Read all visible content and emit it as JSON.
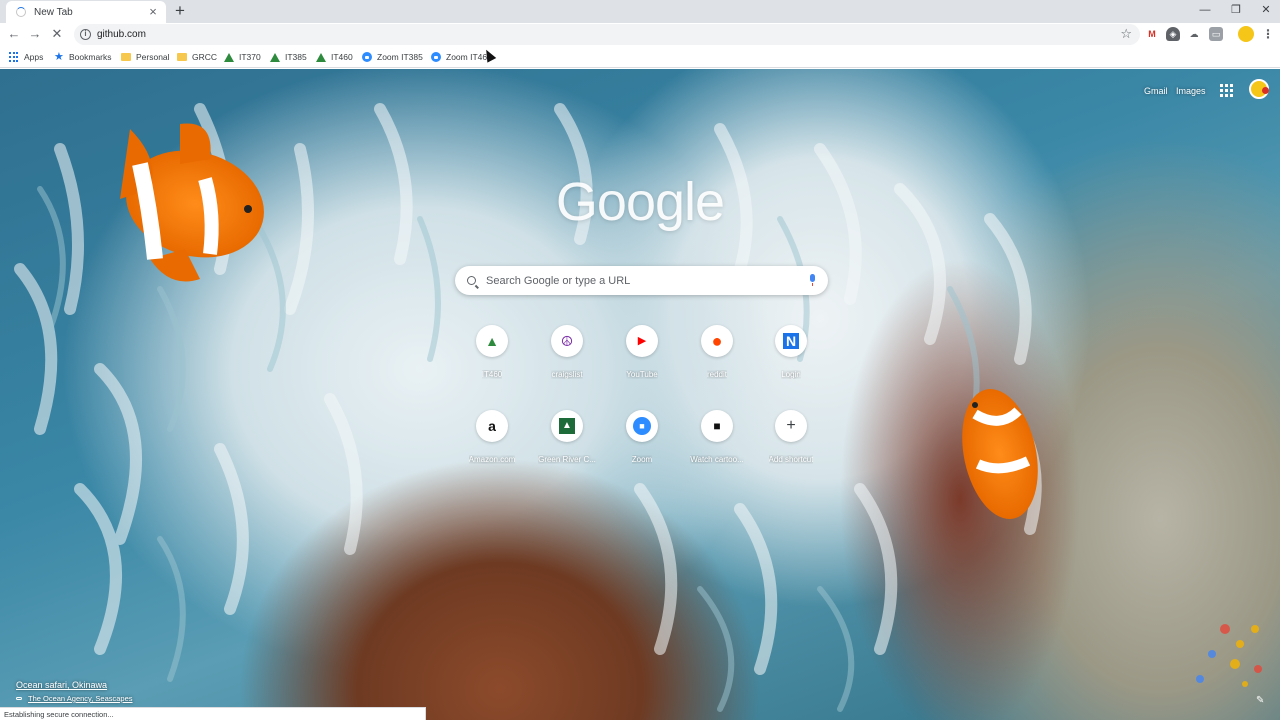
{
  "tab": {
    "title": "New Tab"
  },
  "window_controls": {
    "minimize": "—",
    "restore": "❐",
    "close": "✕"
  },
  "toolbar": {
    "url": "github.com"
  },
  "bookmarks": [
    {
      "label": "Apps",
      "icon": "apps-grid-icon"
    },
    {
      "label": "Bookmarks",
      "icon": "star-icon"
    },
    {
      "label": "Personal",
      "icon": "folder-icon"
    },
    {
      "label": "GRCC",
      "icon": "folder-icon"
    },
    {
      "label": "IT370",
      "icon": "triangle-logo-icon"
    },
    {
      "label": "IT385",
      "icon": "triangle-logo-icon"
    },
    {
      "label": "IT460",
      "icon": "triangle-logo-icon"
    },
    {
      "label": "Zoom IT385",
      "icon": "zoom-icon"
    },
    {
      "label": "Zoom IT460",
      "icon": "zoom-icon"
    }
  ],
  "header": {
    "gmail": "Gmail",
    "images": "Images"
  },
  "logo": "Google",
  "search": {
    "placeholder": "Search Google or type a URL"
  },
  "shortcuts": [
    {
      "label": "IT460",
      "glyph": "▲",
      "color": "#2e8b3e"
    },
    {
      "label": "craigslist",
      "glyph": "☮",
      "color": "#7b2fa8"
    },
    {
      "label": "YouTube",
      "glyph": "▶",
      "color": "#ff0000"
    },
    {
      "label": "reddit",
      "glyph": "●",
      "color": "#ff4500"
    },
    {
      "label": "Login",
      "glyph": "N",
      "color": "#1a73e8"
    },
    {
      "label": "Amazon.com",
      "glyph": "a",
      "color": "#111111"
    },
    {
      "label": "Green River C...",
      "glyph": "▲",
      "color": "#1e6b3a"
    },
    {
      "label": "Zoom",
      "glyph": "■",
      "color": "#2d8cff"
    },
    {
      "label": "Watch cartoo...",
      "glyph": "■",
      "color": "#111111"
    },
    {
      "label": "Add shortcut",
      "glyph": "+",
      "color": "#3c4043"
    }
  ],
  "attribution": {
    "title": "Ocean safari, Okinawa",
    "credit": "The Ocean Agency, Seascapes"
  },
  "status": "Establishing secure connection..."
}
